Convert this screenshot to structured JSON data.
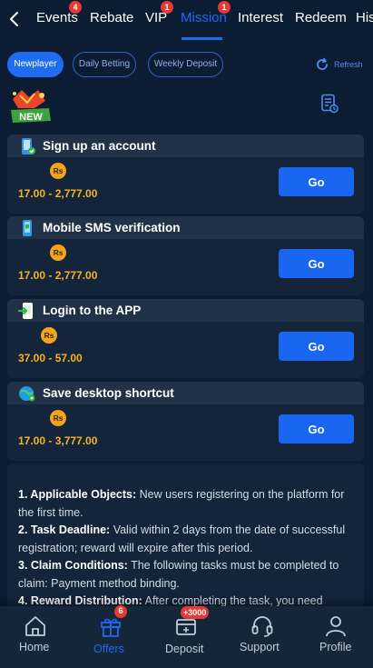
{
  "nav": {
    "tabs": [
      {
        "label": "Events",
        "badge": "4"
      },
      {
        "label": "Rebate"
      },
      {
        "label": "VIP",
        "badge": "1"
      },
      {
        "label": "Mission",
        "badge": "1",
        "active": true
      },
      {
        "label": "Interest"
      },
      {
        "label": "Redeem"
      },
      {
        "label": "His"
      }
    ]
  },
  "filters": {
    "options": [
      "Newplayer",
      "Daily Betting",
      "Weekly Deposit"
    ],
    "selected": "Newplayer",
    "refresh_label": "Refresh"
  },
  "new_badge": {
    "text": "NEW"
  },
  "tasks": [
    {
      "title": "Sign up an account",
      "currency": "Rs",
      "reward_range": "17.00 - 2,777.00",
      "action_label": "Go",
      "icon": "phone-check-icon"
    },
    {
      "title": "Mobile SMS verification",
      "currency": "Rs",
      "reward_range": "17.00 - 2,777.00",
      "action_label": "Go",
      "icon": "mobile-sms-icon"
    },
    {
      "title": "Login to the APP",
      "currency": "Rs",
      "reward_range": "37.00 - 57.00",
      "action_label": "Go",
      "icon": "app-login-icon"
    },
    {
      "title": "Save desktop shortcut",
      "currency": "Rs",
      "reward_range": "17.00 - 3,777.00",
      "action_label": "Go",
      "icon": "desktop-shortcut-icon"
    }
  ],
  "rules": [
    {
      "label": "1. Applicable Objects:",
      "text": "New users registering on the platform for the first time."
    },
    {
      "label": "2. Task Deadline:",
      "text": "Valid within 2 days from the date of successful registration; reward will expire after this period."
    },
    {
      "label": "3. Claim Conditions:",
      "text": "The following tasks must be completed to claim: Payment method binding."
    },
    {
      "label": "4. Reward Distribution:",
      "text": "After completing the task, you need"
    }
  ],
  "bottom_nav": [
    {
      "label": "Home",
      "icon": "home-icon"
    },
    {
      "label": "Offers",
      "icon": "gift-icon",
      "badge": "6",
      "active": true
    },
    {
      "label": "Deposit",
      "icon": "deposit-icon",
      "badge": "+3000"
    },
    {
      "label": "Support",
      "icon": "headset-icon"
    },
    {
      "label": "Profile",
      "icon": "profile-icon"
    }
  ],
  "colors": {
    "accent": "#1d6cf2",
    "background": "#0c1c32",
    "card": "#14243b",
    "reward": "#f7b31e",
    "badge": "#e53935"
  }
}
